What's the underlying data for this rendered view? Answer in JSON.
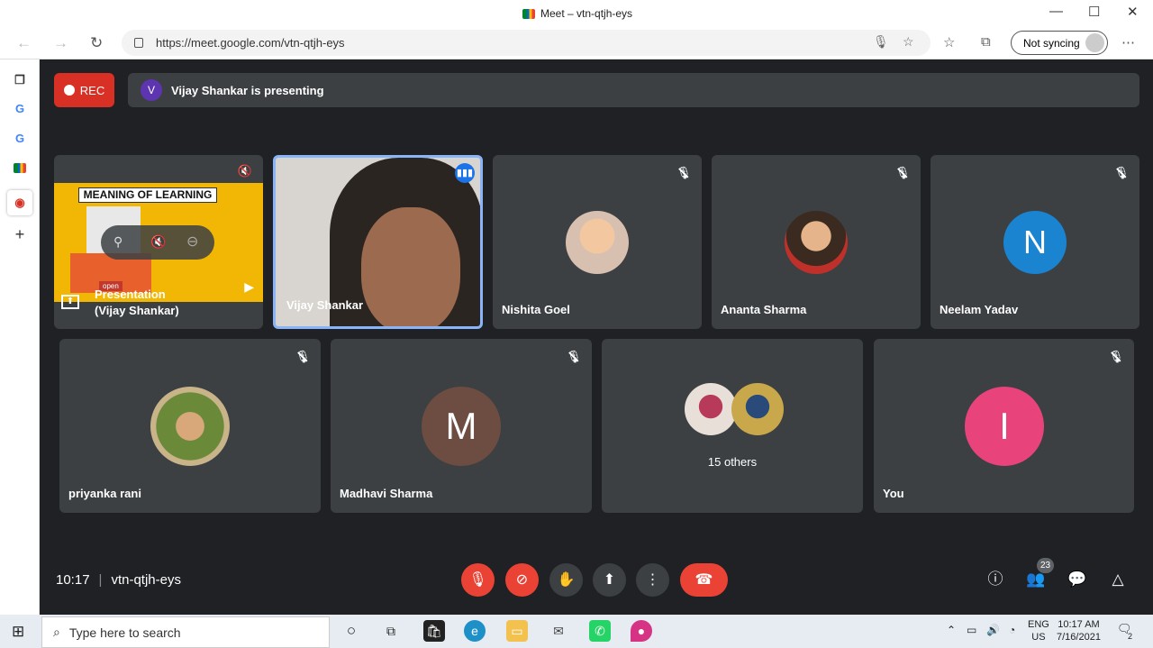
{
  "browser": {
    "tab_title": "Meet – vtn-qtjh-eys",
    "url": "https://meet.google.com/vtn-qtjh-eys",
    "sync_label": "Not syncing",
    "minimize": "—",
    "maximize": "☐",
    "close": "✕"
  },
  "meet": {
    "rec_label": "REC",
    "presenter_initial": "V",
    "presenting_text": "Vijay Shankar is presenting",
    "time": "10:17",
    "meeting_code": "vtn-qtjh-eys",
    "participants_badge": "23",
    "tiles_row1": [
      {
        "name_line1": "Presentation",
        "name_line2": "(Vijay Shankar)",
        "slide_title": "MEANING OF LEARNING",
        "slide_open": "open"
      },
      {
        "name": "Vijay Shankar"
      },
      {
        "name": "Nishita Goel"
      },
      {
        "name": "Ananta Sharma"
      },
      {
        "name": "Neelam Yadav",
        "initial": "N"
      }
    ],
    "tiles_row2": [
      {
        "name": "priyanka rani"
      },
      {
        "name": "Madhavi Sharma",
        "initial": "M"
      },
      {
        "name": "15 others"
      },
      {
        "name": "You",
        "initial": "I"
      }
    ]
  },
  "taskbar": {
    "search_placeholder": "Type here to search",
    "lang_top": "ENG",
    "lang_bottom": "US",
    "clock_time": "10:17 AM",
    "clock_date": "7/16/2021",
    "notif_count": "2"
  },
  "colors": {
    "neelam": "#1a84d0",
    "madhavi": "#6d4c41",
    "you": "#e8437a",
    "presenter_border": "#8ab4f8"
  }
}
